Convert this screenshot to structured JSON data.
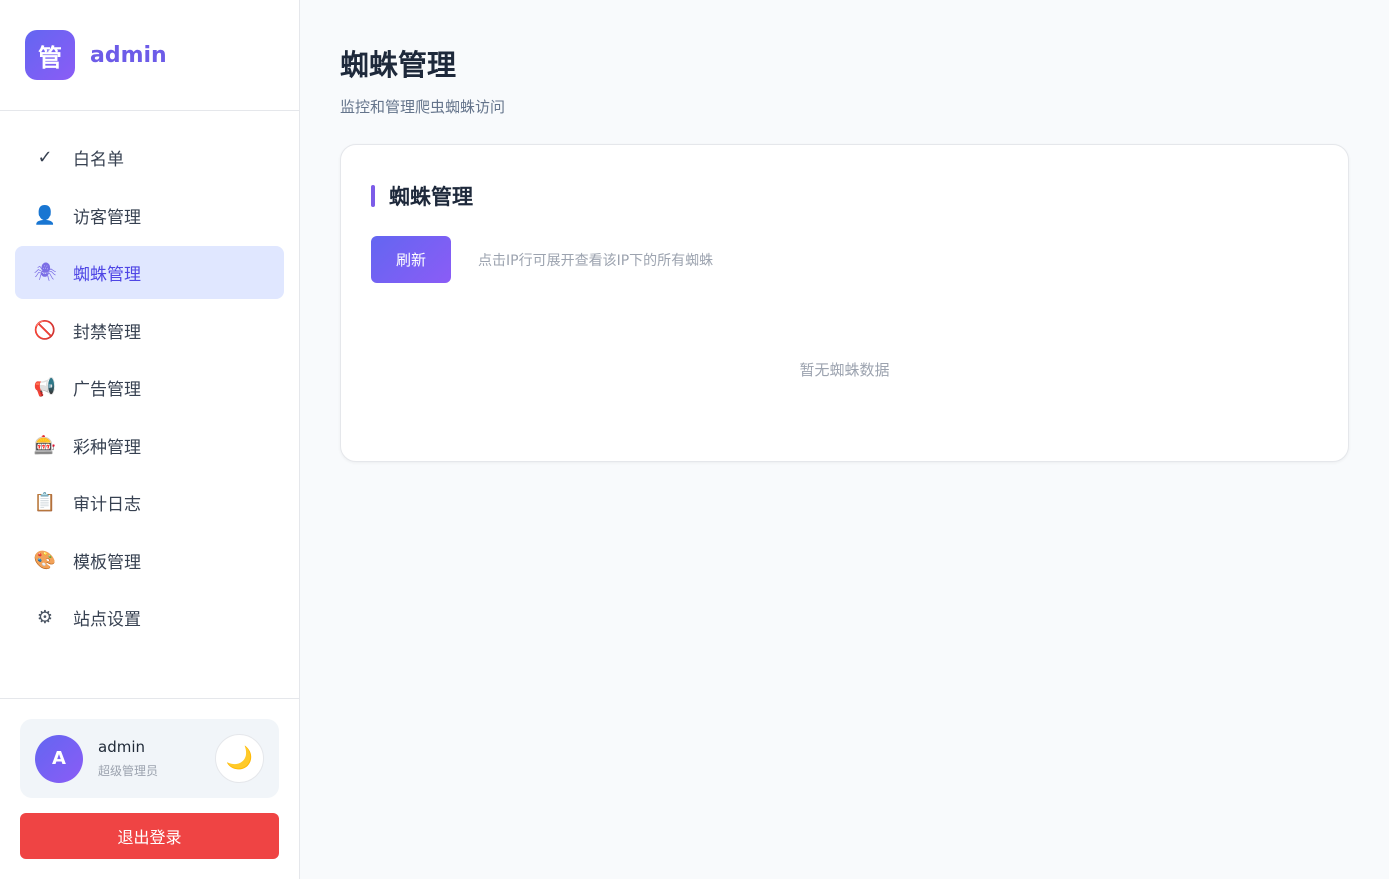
{
  "brand": {
    "logo_char": "管",
    "name": "admin"
  },
  "nav": {
    "items": [
      {
        "label": "白名单",
        "icon": "✓",
        "icon_name": "check-icon"
      },
      {
        "label": "访客管理",
        "icon": "👤",
        "icon_name": "visitor-icon"
      },
      {
        "label": "蜘蛛管理",
        "icon": "🕷",
        "icon_name": "spider-icon",
        "active": true
      },
      {
        "label": "封禁管理",
        "icon": "🚫",
        "icon_name": "ban-icon"
      },
      {
        "label": "广告管理",
        "icon": "📢",
        "icon_name": "megaphone-icon"
      },
      {
        "label": "彩种管理",
        "icon": "🎰",
        "icon_name": "slot-machine-icon"
      },
      {
        "label": "审计日志",
        "icon": "📋",
        "icon_name": "clipboard-icon"
      },
      {
        "label": "模板管理",
        "icon": "🎨",
        "icon_name": "palette-icon"
      },
      {
        "label": "站点设置",
        "icon": "⚙",
        "icon_name": "gear-icon"
      }
    ]
  },
  "user": {
    "avatar_letter": "A",
    "name": "admin",
    "role": "超级管理员",
    "theme_icon": "🌙"
  },
  "logout_label": "退出登录",
  "page": {
    "title": "蜘蛛管理",
    "subtitle": "监控和管理爬虫蜘蛛访问"
  },
  "card": {
    "title": "蜘蛛管理",
    "refresh_label": "刷新",
    "hint": "点击IP行可展开查看该IP下的所有蜘蛛",
    "empty_text": "暂无蜘蛛数据"
  },
  "colors": {
    "accent": "#6d5ce8",
    "active_bg": "#e0e7ff",
    "danger": "#ef4444"
  }
}
